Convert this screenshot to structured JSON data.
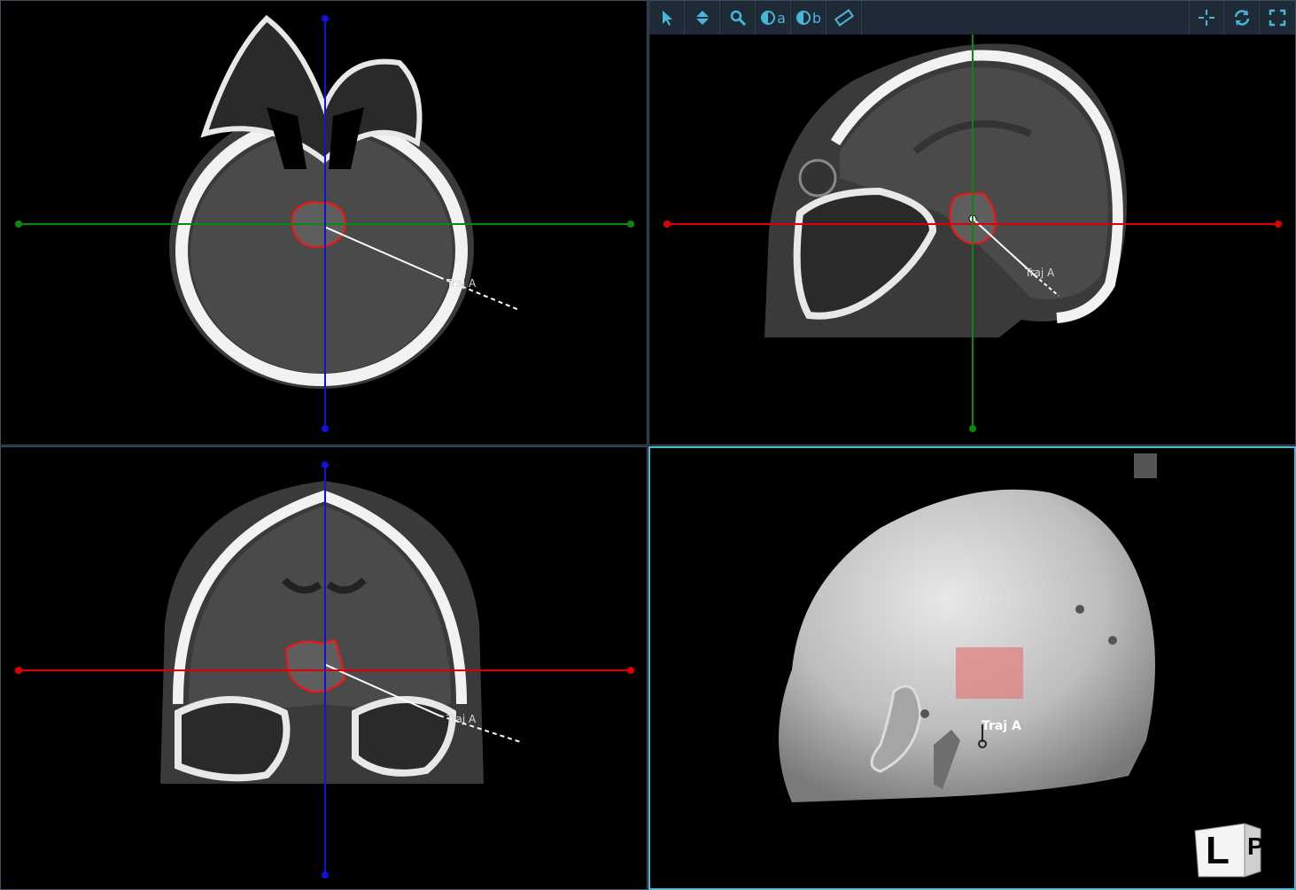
{
  "toolbar": {
    "tools": [
      {
        "id": "select",
        "icon": "pointer-icon"
      },
      {
        "id": "scroll",
        "icon": "scroll-slice-icon"
      },
      {
        "id": "zoom",
        "icon": "magnifier-icon"
      },
      {
        "id": "window-a",
        "icon": "contrast-icon",
        "suffix": "a"
      },
      {
        "id": "window-b",
        "icon": "contrast-icon",
        "suffix": "b"
      },
      {
        "id": "measure",
        "icon": "ruler-icon"
      }
    ],
    "right_tools": [
      {
        "id": "crosshair",
        "icon": "crosshair-icon"
      },
      {
        "id": "reset",
        "icon": "rotate-icon"
      },
      {
        "id": "fullscreen",
        "icon": "fullscreen-icon"
      }
    ]
  },
  "viewports": {
    "axial": {
      "trajectory_label": "Traj A"
    },
    "sagittal": {
      "trajectory_label": "Traj A"
    },
    "coronal": {
      "trajectory_label": "Traj A"
    },
    "volume3d": {
      "trajectory_label": "Traj A",
      "orientation_letters": [
        "L",
        "P"
      ]
    }
  },
  "colors": {
    "axis_blue": "#1010e0",
    "axis_green": "#0a8a0a",
    "axis_red": "#e00000",
    "segmentation": "#ff1010",
    "active_border": "#4fb9d6",
    "toolbar_icon": "#48b6d8"
  }
}
